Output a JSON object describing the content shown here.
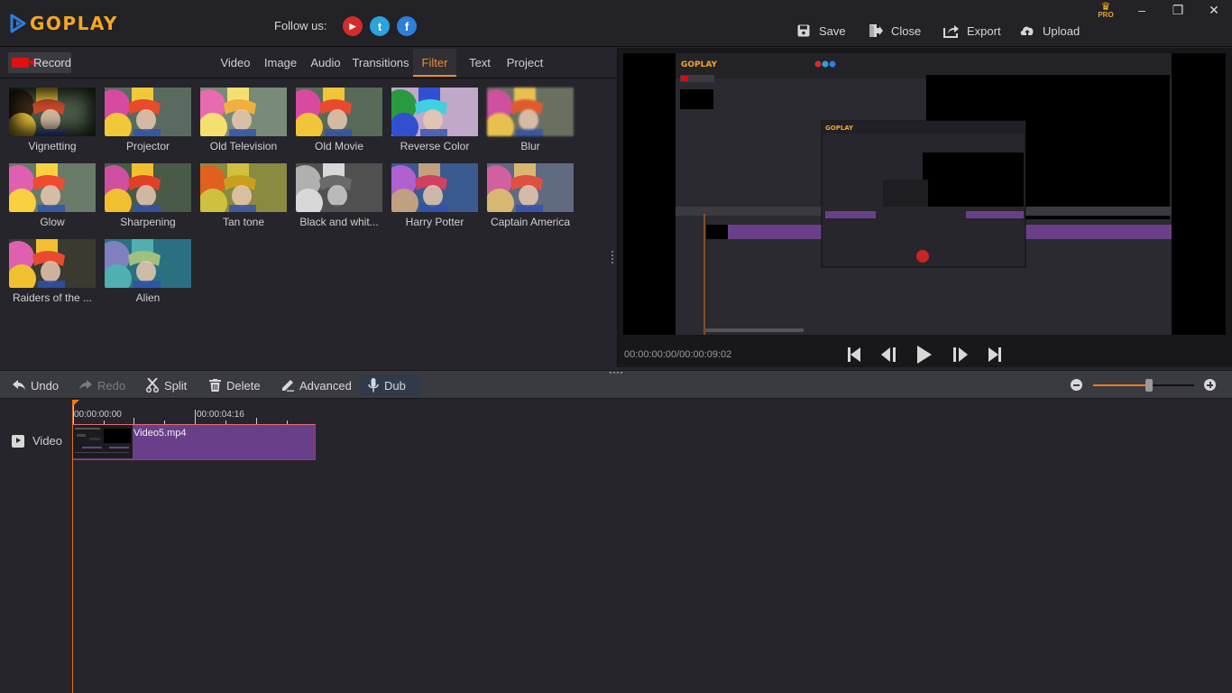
{
  "app": {
    "name": "GOPLAY",
    "follow_label": "Follow us:",
    "social": [
      {
        "name": "youtube",
        "glyph": "▶"
      },
      {
        "name": "twitter",
        "glyph": "t"
      },
      {
        "name": "facebook",
        "glyph": "f"
      }
    ],
    "pro_label": "PRO",
    "window_controls": {
      "minimize": "–",
      "restore": "❐",
      "close": "✕"
    }
  },
  "header_actions": [
    {
      "label": "Save",
      "icon": "save-icon"
    },
    {
      "label": "Close",
      "icon": "exit-icon"
    },
    {
      "label": "Export",
      "icon": "export-icon"
    },
    {
      "label": "Upload",
      "icon": "upload-icon"
    }
  ],
  "left_panel": {
    "record_label": "Record",
    "tabs": [
      {
        "label": "Video",
        "active": false
      },
      {
        "label": "Image",
        "active": false
      },
      {
        "label": "Audio",
        "active": false
      },
      {
        "label": "Transitions",
        "active": false
      },
      {
        "label": "Filter",
        "active": true
      },
      {
        "label": "Text",
        "active": false
      },
      {
        "label": "Project",
        "active": false
      }
    ],
    "filters": [
      {
        "label": "Vignetting"
      },
      {
        "label": "Projector"
      },
      {
        "label": "Old Television"
      },
      {
        "label": "Old Movie"
      },
      {
        "label": "Reverse Color"
      },
      {
        "label": "Blur"
      },
      {
        "label": "Glow"
      },
      {
        "label": "Sharpening"
      },
      {
        "label": "Tan tone"
      },
      {
        "label": "Black and whit..."
      },
      {
        "label": "Harry Potter"
      },
      {
        "label": "Captain America"
      },
      {
        "label": "Raiders of the ..."
      },
      {
        "label": "Alien"
      }
    ]
  },
  "preview": {
    "timecode": "00:00:00:00/00:00:09:02",
    "controls": [
      "skip-to-start",
      "previous-frame",
      "play",
      "next-frame",
      "skip-to-end"
    ]
  },
  "toolbar": {
    "undo": "Undo",
    "redo": "Redo",
    "split": "Split",
    "delete": "Delete",
    "advanced": "Advanced",
    "dub": "Dub",
    "zoom_level_percent": 55
  },
  "timeline": {
    "track_label": "Video",
    "ruler_labels": [
      "00:00:00:00",
      "00:00:04:16"
    ],
    "clip_name": "Video5.mp4"
  },
  "colors": {
    "accent": "#ef8a2a",
    "clip": "#6a3f8a",
    "clip_border": "#c0314a",
    "logo": "#f4a623",
    "logo_mark": "#2d7fd8"
  }
}
